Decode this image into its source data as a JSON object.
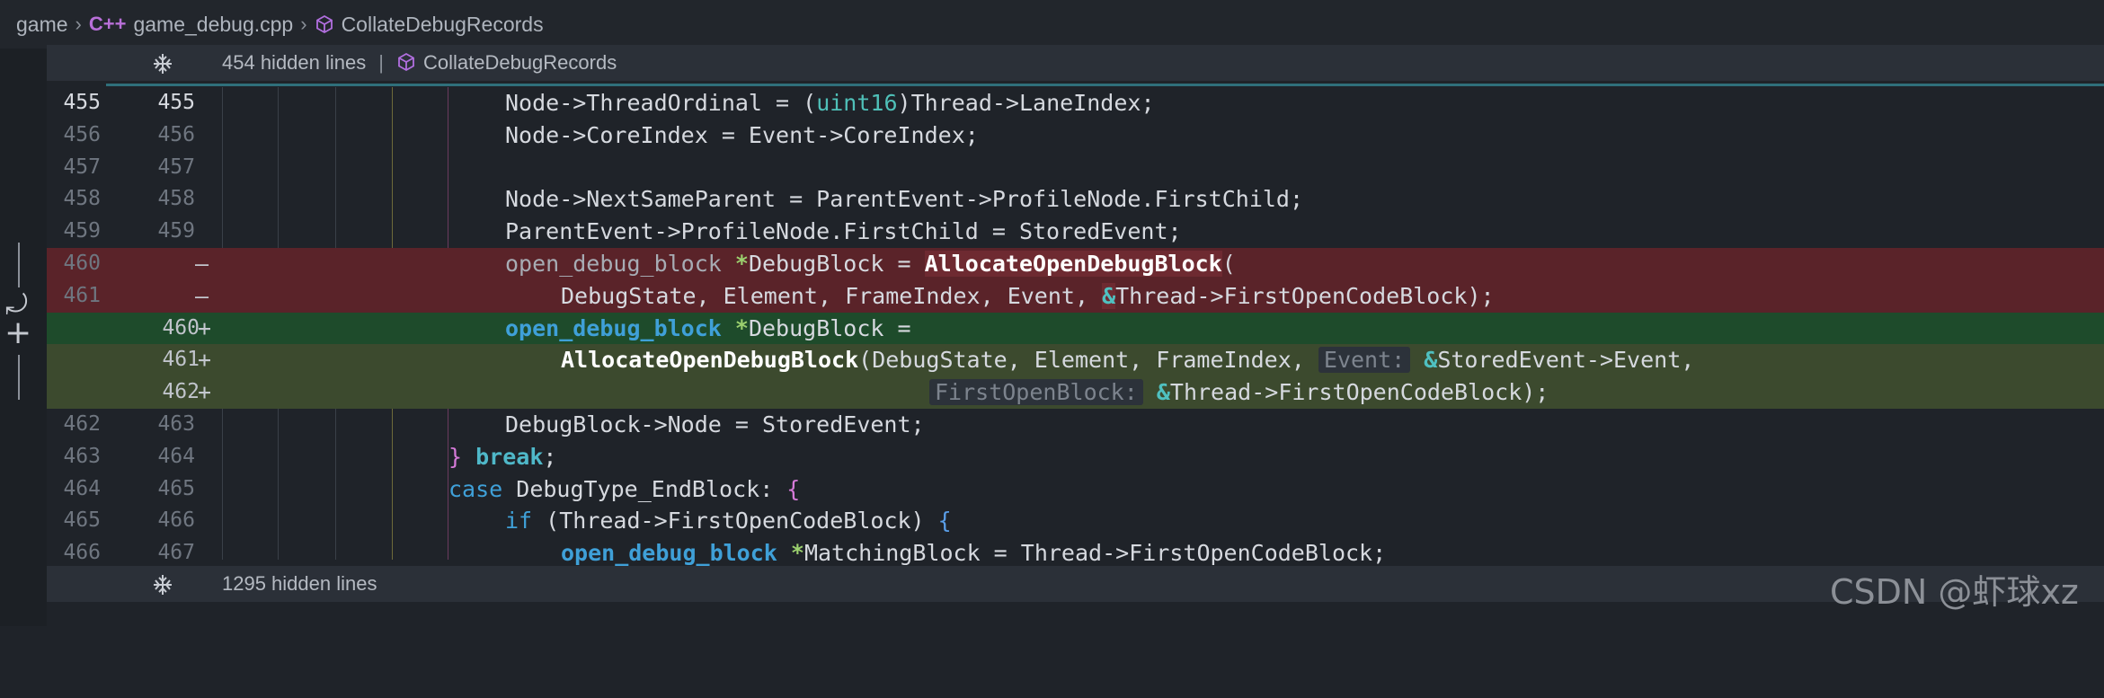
{
  "breadcrumb": {
    "folder": "game",
    "file": "game_debug.cpp",
    "file_icon": "C++",
    "symbol": "CollateDebugRecords"
  },
  "fold_top": {
    "text": "454 hidden lines",
    "pipe": "|",
    "symbol": "CollateDebugRecords"
  },
  "fold_bottom": {
    "text": "1295 hidden lines"
  },
  "controls": {
    "revert": "⤾",
    "add": "+"
  },
  "lines": [
    {
      "old": "455",
      "new": "455",
      "mark": "",
      "kind": "normal"
    },
    {
      "old": "456",
      "new": "456",
      "mark": "",
      "kind": "normal"
    },
    {
      "old": "457",
      "new": "457",
      "mark": "",
      "kind": "normal"
    },
    {
      "old": "458",
      "new": "458",
      "mark": "",
      "kind": "normal"
    },
    {
      "old": "459",
      "new": "459",
      "mark": "",
      "kind": "normal"
    },
    {
      "old": "460",
      "new": "",
      "mark": "—",
      "kind": "del"
    },
    {
      "old": "461",
      "new": "",
      "mark": "—",
      "kind": "del"
    },
    {
      "old": "",
      "new": "460",
      "mark": "+",
      "kind": "add"
    },
    {
      "old": "",
      "new": "461",
      "mark": "+",
      "kind": "add2"
    },
    {
      "old": "",
      "new": "462",
      "mark": "+",
      "kind": "add2"
    },
    {
      "old": "462",
      "new": "463",
      "mark": "",
      "kind": "normal"
    },
    {
      "old": "463",
      "new": "464",
      "mark": "",
      "kind": "normal"
    },
    {
      "old": "464",
      "new": "465",
      "mark": "",
      "kind": "normal"
    },
    {
      "old": "465",
      "new": "466",
      "mark": "",
      "kind": "normal"
    },
    {
      "old": "466",
      "new": "467",
      "mark": "",
      "kind": "normal"
    }
  ],
  "code": {
    "l455": [
      "Node->ThreadOrdinal = ",
      "(",
      "uint16",
      ")Thread->LaneIndex;"
    ],
    "l456": "Node->CoreIndex = Event->CoreIndex;",
    "l458": "Node->NextSameParent = ParentEvent->ProfileNode.FirstChild;",
    "l459": "ParentEvent->ProfileNode.FirstChild = StoredEvent;",
    "l460d": [
      "open_debug_block ",
      "*",
      "DebugBlock = ",
      "AllocateOpenDebugBlock",
      "("
    ],
    "l461d": [
      "DebugState, Element, FrameIndex, Event, ",
      "&",
      "Thread->FirstOpenCodeBlock);"
    ],
    "l460a": [
      "open_debug_block",
      " ",
      "*",
      "DebugBlock ="
    ],
    "l461a": [
      "AllocateOpenDebugBlock",
      "(DebugState, Element, FrameIndex, ",
      "Event:",
      " ",
      "&",
      "StoredEvent->Event,"
    ],
    "l462a": [
      "FirstOpenBlock:",
      " ",
      "&",
      "Thread->FirstOpenCodeBlock);"
    ],
    "l463": "DebugBlock->Node = StoredEvent;",
    "l464": [
      "}",
      " ",
      "break",
      ";"
    ],
    "l465": [
      "case",
      " DebugType_EndBlock: ",
      "{"
    ],
    "l466": [
      "if",
      " (Thread->FirstOpenCodeBlock) ",
      "{"
    ],
    "l467": [
      "open_debug_block",
      " ",
      "*",
      "MatchingBlock = Thread->FirstOpenCodeBlock;"
    ]
  },
  "watermark": "CSDN @虾球xz",
  "colors": {
    "deleted_bg": "#5a2329",
    "added_bg": "#1e4b2b",
    "added_hint_bg": "#3c4a2e",
    "keyword": "#3fa0d8",
    "brace": "#d57ad8"
  }
}
